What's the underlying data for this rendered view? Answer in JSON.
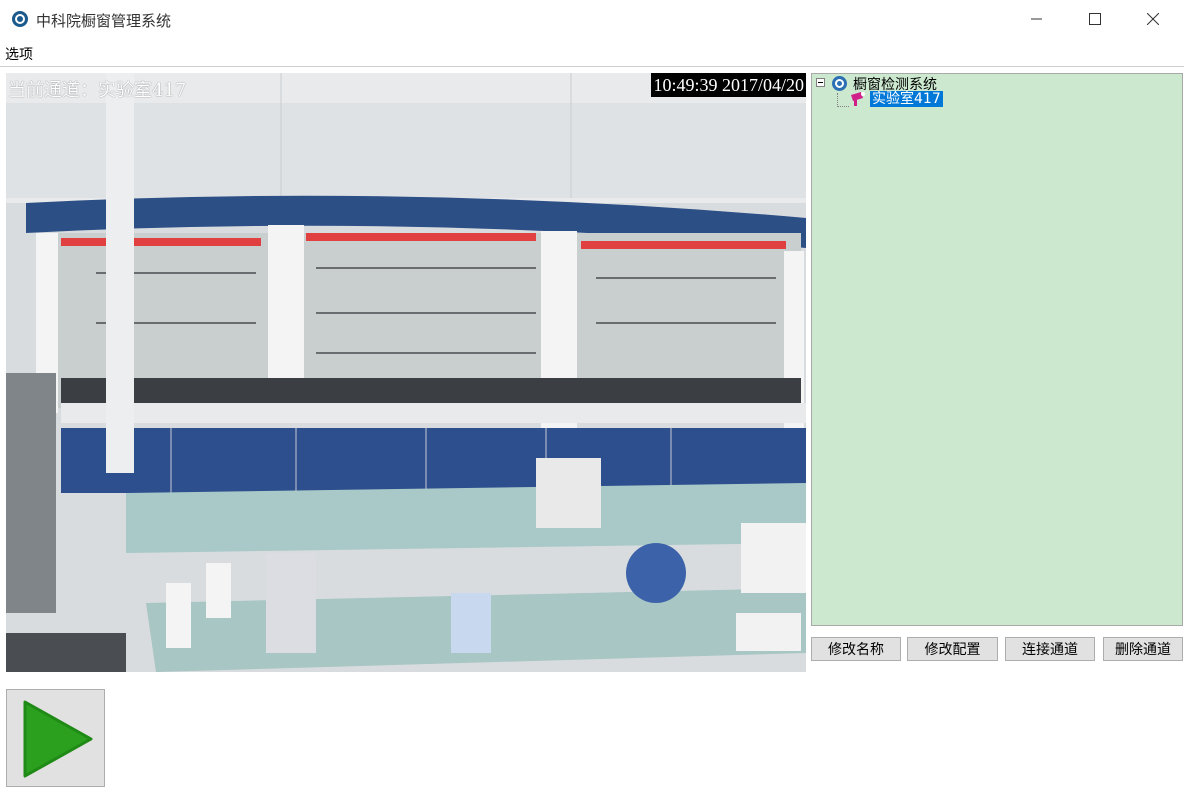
{
  "window": {
    "title": "中科院橱窗管理系统",
    "app_icon": "app-logo-icon",
    "controls": [
      "minimize-icon",
      "maximize-icon",
      "close-icon"
    ]
  },
  "menu": {
    "items": [
      {
        "label": "选项"
      }
    ]
  },
  "video": {
    "channel_text": "当前通道：实验室417",
    "timestamp": "10:49:39 2017/04/20"
  },
  "tree": {
    "root": {
      "label": "橱窗检测系统",
      "icon": "system-globe-icon"
    },
    "children": [
      {
        "label": "实验室417",
        "icon": "camera-icon",
        "selected": true
      }
    ]
  },
  "buttons": {
    "rename": "修改名称",
    "config": "修改配置",
    "connect": "连接通道",
    "delete": "删除通道"
  },
  "play": {
    "icon": "play-icon",
    "color": "#2aa01e"
  }
}
